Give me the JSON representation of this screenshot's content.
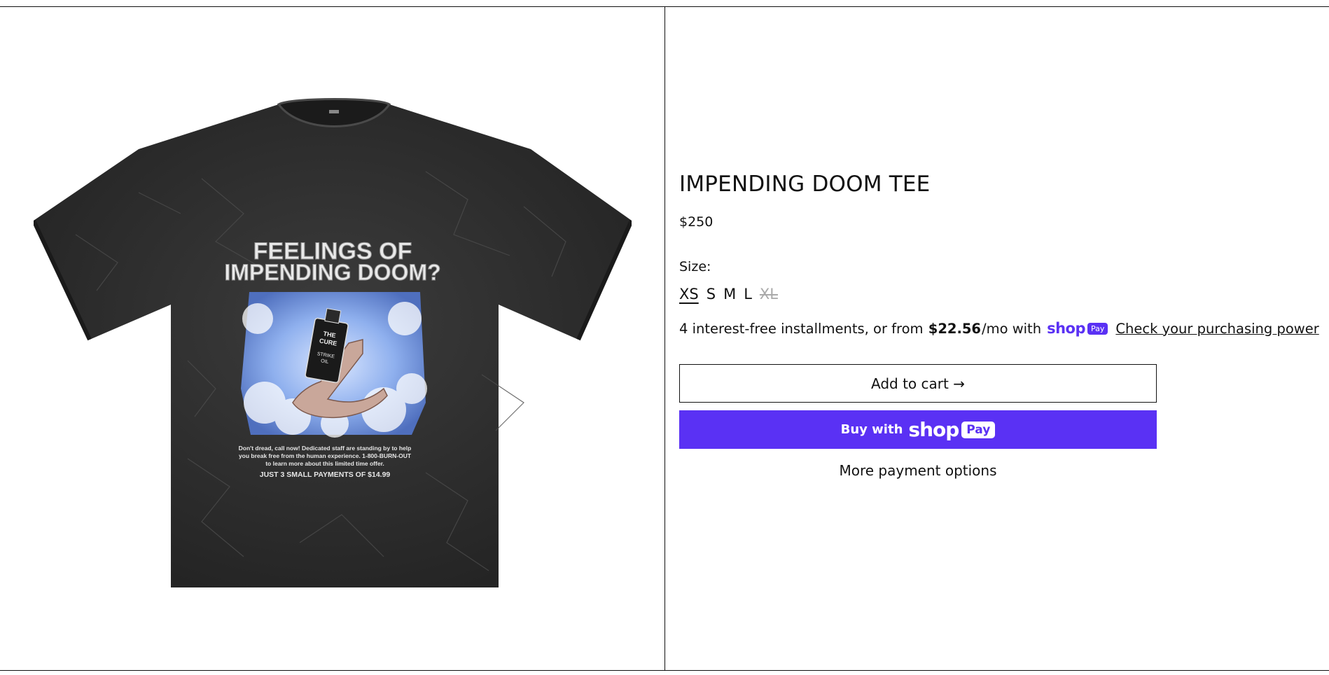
{
  "product": {
    "title": "IMPENDING DOOM TEE",
    "price": "$250",
    "image": {
      "headline_line1": "FEELINGS OF",
      "headline_line2": "IMPENDING DOOM?",
      "bottle_text": [
        "THE",
        "CURE",
        "STRIKE",
        "OIL"
      ],
      "body_lines": [
        "Don't dread, call now! Dedicated staff are standing by to help",
        "you break free from the human experience. 1-800-BURN-OUT",
        "to learn more about this limited time offer."
      ],
      "footer_line": "JUST 3 SMALL PAYMENTS OF $14.99"
    }
  },
  "size": {
    "label": "Size:",
    "options": [
      "XS",
      "S",
      "M",
      "L",
      "XL"
    ],
    "selected": "XS",
    "unavailable": [
      "XL"
    ]
  },
  "installments": {
    "prefix": "4 interest-free installments, or from",
    "amount": "$22.56",
    "suffix": "/mo with",
    "shop_word": "shop",
    "pay_badge": "Pay",
    "link": "Check your purchasing power"
  },
  "buttons": {
    "add_to_cart": "Add to cart →",
    "buy_with": "Buy with",
    "shop_logo": "shop",
    "pay_logo": "Pay",
    "more_options": "More payment options"
  },
  "colors": {
    "shop_pay_purple": "#5a31f4",
    "border": "#111111",
    "unavailable": "#aaaaaa"
  }
}
